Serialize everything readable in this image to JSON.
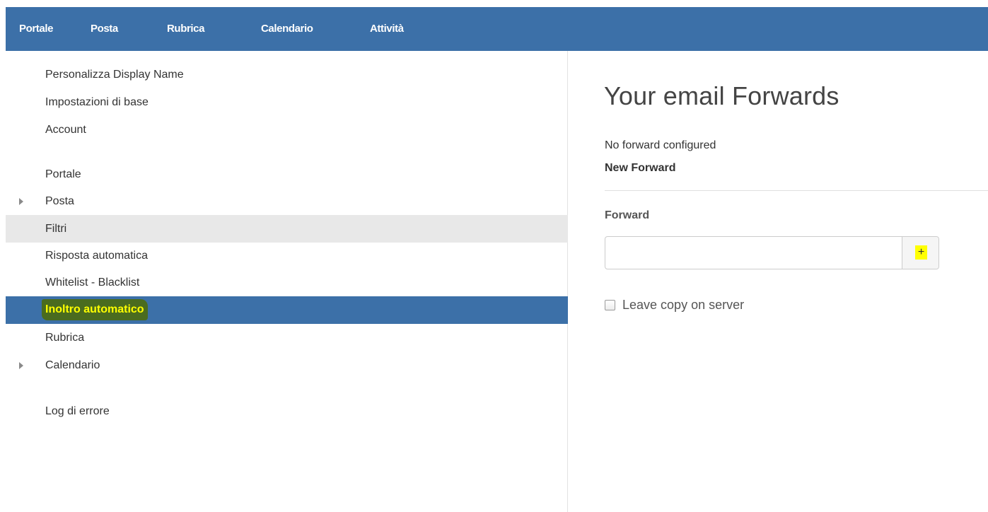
{
  "topnav": {
    "items": [
      {
        "label": "Portale"
      },
      {
        "label": "Posta"
      },
      {
        "label": "Rubrica"
      },
      {
        "label": "Calendario"
      },
      {
        "label": "Attività"
      }
    ]
  },
  "sidebar": {
    "items": [
      {
        "label": "Personalizza Display Name"
      },
      {
        "label": "Impostazioni di base"
      },
      {
        "label": "Account"
      },
      {
        "label": "Portale"
      },
      {
        "label": "Posta",
        "expandable": true
      },
      {
        "label": "Filtri",
        "state": "hover"
      },
      {
        "label": "Risposta automatica"
      },
      {
        "label": "Whitelist - Blacklist"
      },
      {
        "label": "Inoltro automatico",
        "state": "active"
      },
      {
        "label": "Rubrica"
      },
      {
        "label": "Calendario",
        "expandable": true
      },
      {
        "label": "Log di errore"
      }
    ]
  },
  "main": {
    "title": "Your email Forwards",
    "status_text": "No forward configured",
    "new_forward_heading": "New Forward",
    "forward_label": "Forward",
    "forward_input": {
      "value": "",
      "placeholder": ""
    },
    "add_button_label": "+",
    "leave_copy": {
      "label": "Leave copy on server",
      "checked": false
    }
  },
  "colors": {
    "nav_background": "#3c70a8",
    "active_item_background": "#3c70a8",
    "highlight_yellow": "#ffff00",
    "marker_green": "#4a6b1f",
    "hover_background": "#e8e8e8"
  }
}
